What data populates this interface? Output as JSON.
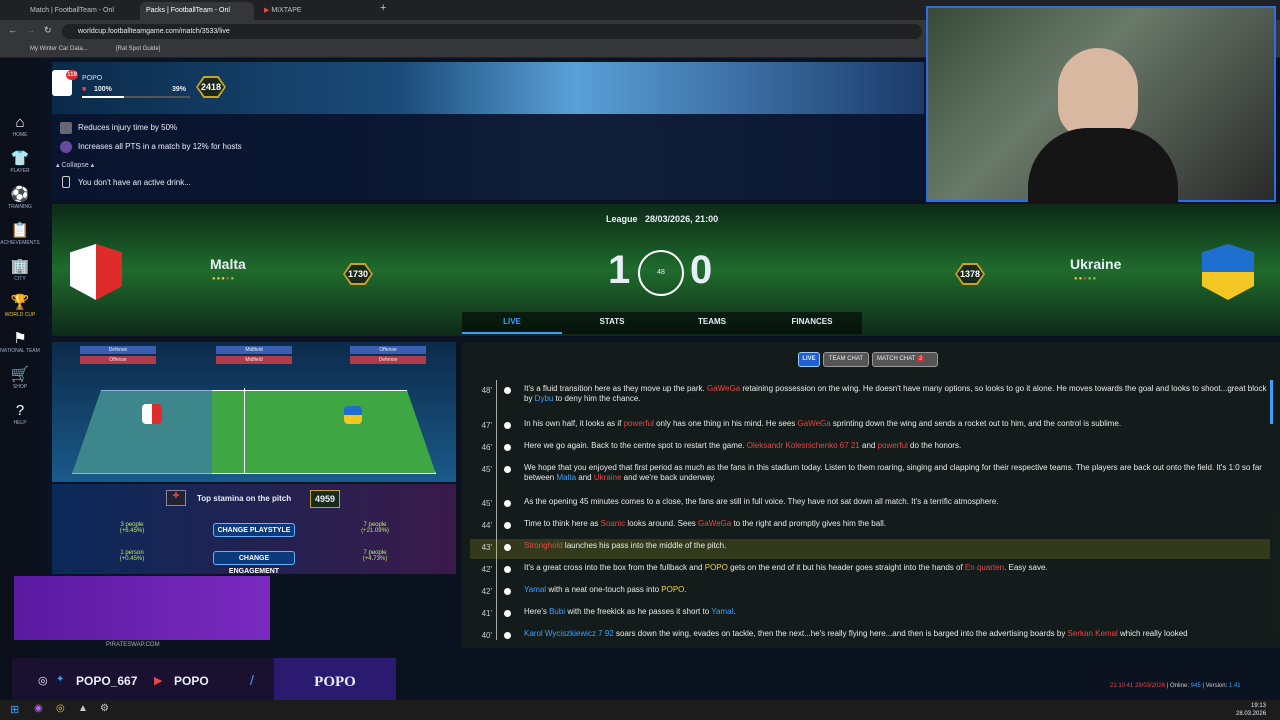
{
  "browser": {
    "tabs": [
      "Match | FootballTeam - Onl",
      "Packs | FootballTeam - Onl",
      "MIXTAPE"
    ],
    "url": "worldcup.footballteamgame.com/match/3533/live",
    "bookmarks": [
      "My Winter Car Data...",
      "[Rat Spot Guide]"
    ]
  },
  "sidebar": [
    {
      "icon": "home-icon",
      "glyph": "⌂",
      "label": "HOME"
    },
    {
      "icon": "shirt-icon",
      "glyph": "👕",
      "label": "PLAYER"
    },
    {
      "icon": "ball-icon",
      "glyph": "⚽",
      "label": "TRAINING"
    },
    {
      "icon": "clipboard-icon",
      "glyph": "📋",
      "label": "ACHIEVEMENTS"
    },
    {
      "icon": "city-icon",
      "glyph": "🏢",
      "label": "CITY"
    },
    {
      "icon": "trophy-icon",
      "glyph": "🏆",
      "label": "WORLD CUP"
    },
    {
      "icon": "flag-icon",
      "glyph": "⚑",
      "label": "NATIONAL TEAM"
    },
    {
      "icon": "cart-icon",
      "glyph": "🛒",
      "label": "SHOP"
    },
    {
      "icon": "help-icon",
      "glyph": "?",
      "label": "HELP"
    }
  ],
  "player": {
    "name": "POPO",
    "badge": "119",
    "health": "100%",
    "energy": "39%",
    "energy_level": 0.39,
    "rating": "2418"
  },
  "perks": {
    "items": [
      "Reduces injury time by 50%",
      "Increases all PTS in a match by 12% for hosts"
    ],
    "collapse": "Collapse",
    "drink": "You don't have an active drink..."
  },
  "match": {
    "competition": "League",
    "datetime": "28/03/2026, 21:00",
    "home": {
      "name": "Malta",
      "rating": "1730"
    },
    "away": {
      "name": "Ukraine",
      "rating": "1378"
    },
    "home_score": "1",
    "away_score": "0",
    "minute": "48",
    "tabs": [
      "LIVE",
      "STATS",
      "TEAMS",
      "FINANCES"
    ]
  },
  "pitch": {
    "labels": [
      "Defense",
      "Offense",
      "Midfield",
      "Midfield",
      "Offense",
      "Defense"
    ],
    "stamina_label": "Top stamina on the pitch",
    "stamina": "4959",
    "left1": "3 people",
    "left1b": "(+6.45%)",
    "right1": "7 people",
    "right1b": "(+21.09%)",
    "btn1": "CHANGE PLAYSTYLE",
    "left2": "1 person",
    "left2b": "(+0.45%)",
    "right2": "7 people",
    "right2b": "(+4.73%)",
    "btn2": "CHANGE ENGAGEMENT"
  },
  "chat": {
    "live": "LIVE",
    "team": "TEAM CHAT",
    "match": "MATCH CHAT",
    "match_count": "2"
  },
  "feed": [
    {
      "min": "48'",
      "html": "It's a fluid transition here as they move up the park. <span class=red>GaWeGa</span> retaining possession on the wing. He doesn't have many options, so looks to go it alone. He moves towards the goal and looks to shoot...great block by <span class=blue>Dybu</span> to deny him the chance."
    },
    {
      "min": "47'",
      "html": "In his own half, it looks as if <span class=red>powerful</span> only has one thing in his mind. He sees <span class=red>GaWeGa</span> sprinting down the wing and sends a rocket out to him, and the control is sublime."
    },
    {
      "min": "46'",
      "html": "Here we go again. Back to the centre spot to restart the game. <span class=red>Oleksandr Kolesnichenko 67 21</span> and <span class=red>powerful</span> do the honors."
    },
    {
      "min": "45'",
      "html": "We hope that you enjoyed that first period as much as the fans in this stadium today. Listen to them roaring, singing and clapping for their respective teams. The players are back out onto the field. It's 1:0 so far between <span class=blue>Malta</span> and <span class=red>Ukraine</span> and we're back underway."
    },
    {
      "min": "45'",
      "html": "As the opening 45 minutes comes to a close, the fans are still in full voice. They have not sat down all match. It's a terrific atmosphere."
    },
    {
      "min": "44'",
      "html": "Time to think here as <span class=red>Soanic</span> looks around. Sees <span class=red>GaWeGa</span> to the right and promptly gives him the ball."
    },
    {
      "min": "43'",
      "html": "<span class=red>Stronghold</span> launches his pass into the middle of the pitch."
    },
    {
      "min": "42'",
      "html": "It's a great cross into the box from the fullback and <span class=yel>POPO</span> gets on the end of it but his header goes straight into the hands of <span class=red>En quarten</span>. Easy save."
    },
    {
      "min": "42'",
      "html": "<span class=blue>Yamal</span> with a neat one-touch pass into <span class=yel>POPO</span>."
    },
    {
      "min": "41'",
      "html": "Here's <span class=blue>Bubi</span> with the freekick as he passes it short to <span class=blue>Yamal</span>."
    },
    {
      "min": "40'",
      "html": "<span class=blue>Karol Wyciszkiewicz 7 92</span> soars down the wing, evades on tackle, then the next...he's really flying here...and then is barged into the advertising boards by <span class=red>Serkan Kemal</span> which really looked"
    }
  ],
  "status": {
    "time": "21:10:41 28/03/2026",
    "online_label": "Online:",
    "online": "945",
    "version_label": "Version:",
    "version": "1.41"
  },
  "overlay": {
    "handle": "POPO_667",
    "yt": "POPO",
    "brand": "POPO",
    "sponsor": "PIRATESWAP.COM"
  },
  "clock": {
    "time": "19:13",
    "date": "28.03.2026"
  },
  "colors": {
    "accent": "#2d6ee0",
    "home_red": "#e02b2b",
    "away_yellow": "#f3c623",
    "away_blue": "#1f6fd1"
  }
}
